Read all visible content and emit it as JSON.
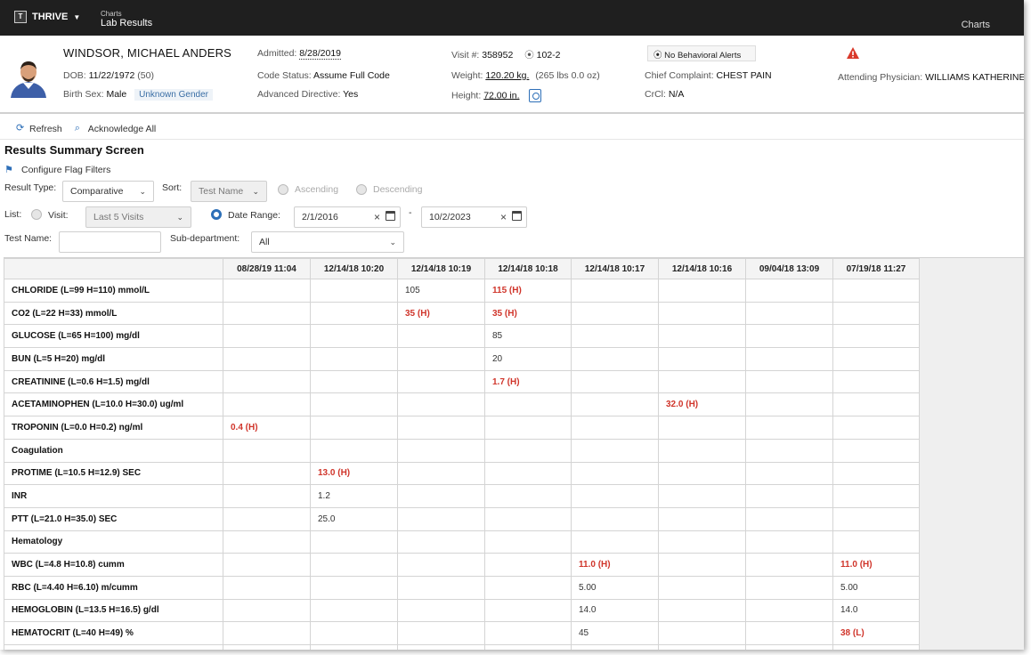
{
  "topbar": {
    "app_name": "THRIVE",
    "app_logo_text": "T",
    "breadcrumb_parent": "Charts",
    "breadcrumb_current": "Lab Results",
    "charts_link": "Charts"
  },
  "patient": {
    "name": "WINDSOR, MICHAEL ANDERS",
    "dob_label": "DOB:",
    "dob_value": "11/22/1972",
    "age": "(50)",
    "birth_sex_label": "Birth Sex:",
    "birth_sex_value": "Male",
    "gender_badge": "Unknown Gender",
    "admitted_label": "Admitted:",
    "admitted_value": "8/28/2019",
    "code_status_label": "Code Status:",
    "code_status_value": "Assume Full Code",
    "adv_directive_label": "Advanced Directive:",
    "adv_directive_value": "Yes",
    "visit_label": "Visit #:",
    "visit_value": "358952",
    "room_value": "102-2",
    "weight_label": "Weight:",
    "weight_value": "120.20 kg.",
    "weight_alt": "(265 lbs 0.0 oz)",
    "height_label": "Height:",
    "height_value": "72.00 in.",
    "behavioral_alert": "No Behavioral Alerts",
    "chief_complaint_label": "Chief Complaint:",
    "chief_complaint_value": "CHEST PAIN",
    "crcl_label": "CrCl:",
    "crcl_value": "N/A",
    "attending_label": "Attending Physician:",
    "attending_value": "WILLIAMS KATHERINE"
  },
  "toolbar": {
    "refresh": "Refresh",
    "acknowledge_all": "Acknowledge All"
  },
  "page": {
    "title": "Results Summary Screen",
    "configure_flags": "Configure Flag Filters"
  },
  "filters": {
    "result_type_label": "Result Type:",
    "result_type_value": "Comparative",
    "sort_label": "Sort:",
    "sort_value": "Test Name",
    "ascending": "Ascending",
    "descending": "Descending",
    "list_label": "List:",
    "visit_label": "Visit:",
    "visit_value": "Last 5 Visits",
    "date_range_label": "Date Range:",
    "date_from": "2/1/2016",
    "date_sep": "-",
    "date_to": "10/2/2023",
    "test_name_label": "Test Name:",
    "test_name_value": "",
    "subdept_label": "Sub-department:",
    "subdept_value": "All"
  },
  "grid": {
    "columns": [
      "",
      "08/28/19 11:04",
      "12/14/18 10:20",
      "12/14/18 10:19",
      "12/14/18 10:18",
      "12/14/18 10:17",
      "12/14/18 10:16",
      "09/04/18 13:09",
      "07/19/18 11:27"
    ],
    "rows": [
      {
        "name": "CHLORIDE (L=99 H=110) mmol/L",
        "cells": [
          "",
          "",
          "105",
          "115 (H)",
          "",
          "",
          "",
          ""
        ]
      },
      {
        "name": "CO2 (L=22 H=33) mmol/L",
        "cells": [
          "",
          "",
          "35 (H)",
          "35 (H)",
          "",
          "",
          "",
          ""
        ]
      },
      {
        "name": "GLUCOSE (L=65 H=100) mg/dl",
        "cells": [
          "",
          "",
          "",
          "85",
          "",
          "",
          "",
          ""
        ]
      },
      {
        "name": "BUN (L=5 H=20) mg/dl",
        "cells": [
          "",
          "",
          "",
          "20",
          "",
          "",
          "",
          ""
        ]
      },
      {
        "name": "CREATININE (L=0.6 H=1.5) mg/dl",
        "cells": [
          "",
          "",
          "",
          "1.7 (H)",
          "",
          "",
          "",
          ""
        ]
      },
      {
        "name": "ACETAMINOPHEN (L=10.0 H=30.0) ug/ml",
        "cells": [
          "",
          "",
          "",
          "",
          "",
          "32.0 (H)",
          "",
          ""
        ]
      },
      {
        "name": "TROPONIN (L=0.0 H=0.2) ng/ml",
        "cells": [
          "0.4 (H)",
          "",
          "",
          "",
          "",
          "",
          "",
          ""
        ]
      },
      {
        "name": "Coagulation",
        "cells": [
          "",
          "",
          "",
          "",
          "",
          "",
          "",
          ""
        ]
      },
      {
        "name": "PROTIME (L=10.5 H=12.9) SEC",
        "cells": [
          "",
          "13.0 (H)",
          "",
          "",
          "",
          "",
          "",
          ""
        ]
      },
      {
        "name": "INR",
        "cells": [
          "",
          "1.2",
          "",
          "",
          "",
          "",
          "",
          ""
        ]
      },
      {
        "name": "PTT (L=21.0 H=35.0) SEC",
        "cells": [
          "",
          "25.0",
          "",
          "",
          "",
          "",
          "",
          ""
        ]
      },
      {
        "name": "Hematology",
        "cells": [
          "",
          "",
          "",
          "",
          "",
          "",
          "",
          ""
        ]
      },
      {
        "name": "WBC (L=4.8 H=10.8) cumm",
        "cells": [
          "",
          "",
          "",
          "",
          "11.0 (H)",
          "",
          "",
          "11.0 (H)"
        ]
      },
      {
        "name": "RBC (L=4.40 H=6.10) m/cumm",
        "cells": [
          "",
          "",
          "",
          "",
          "5.00",
          "",
          "",
          "5.00"
        ]
      },
      {
        "name": "HEMOGLOBIN (L=13.5 H=16.5) g/dl",
        "cells": [
          "",
          "",
          "",
          "",
          "14.0",
          "",
          "",
          "14.0"
        ]
      },
      {
        "name": "HEMATOCRIT (L=40 H=49) %",
        "cells": [
          "",
          "",
          "",
          "",
          "45",
          "",
          "",
          "38 (L)"
        ]
      },
      {
        "name": "",
        "cells": [
          "",
          "",
          "",
          "",
          "",
          "",
          "",
          ""
        ]
      }
    ]
  },
  "colors": {
    "topbar": "#1f1f1f",
    "abnormal": "#d0352b",
    "accent": "#2d6fb8"
  },
  "icons": {
    "refresh": "refresh-icon",
    "acknowledge": "magnifier-check-icon",
    "flag_filters": "flag-filter-icon",
    "warning": "warning-triangle-icon",
    "location": "location-pin-icon",
    "height": "height-measure-icon"
  }
}
